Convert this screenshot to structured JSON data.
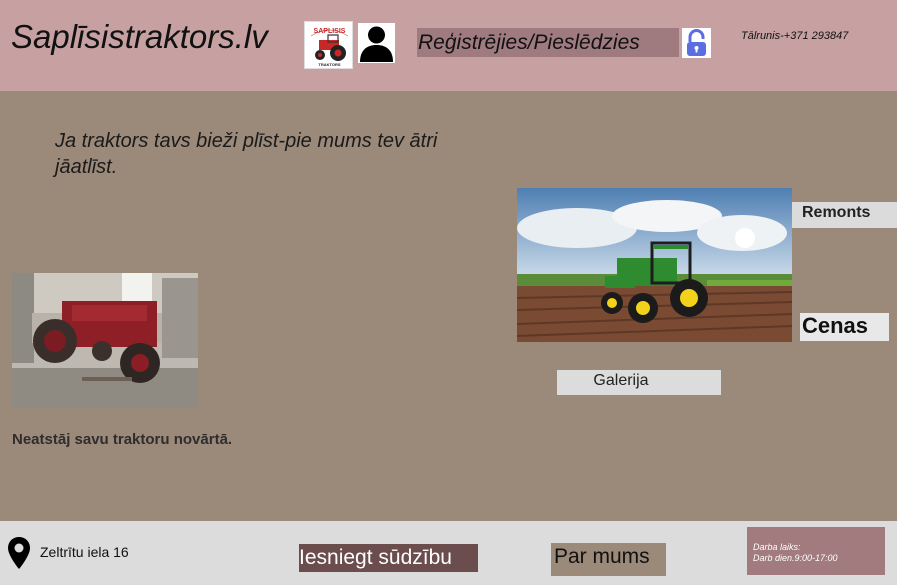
{
  "header": {
    "site_title": "Saplīsistraktors.lv",
    "logo_text": "SAPLISIS",
    "logo_subtext": "TRAKTORS",
    "auth_link": "Reģistrējies/Pieslēdzies",
    "phone": "Tālrunis-+371 293847"
  },
  "main": {
    "slogan": "Ja traktors tavs bieži plīst-pie mums tev ātri jāatlīst.",
    "tagline": "Neatstāj savu traktoru novārtā.",
    "nav": {
      "remonts": "Remonts",
      "cenas": "Cenas",
      "galerija": "Galerija"
    }
  },
  "footer": {
    "address": "Zeltrītu iela 16",
    "complaint_button": "Iesniegt sūdzību",
    "about_button": "Par mums",
    "hours_title": "Darba laiks:",
    "hours_value": "Darb dien.9:00-17:00"
  },
  "colors": {
    "header_bg": "#c7a1a2",
    "main_bg": "#9b8979",
    "footer_bg": "#dcdcdc",
    "auth_link_bg": "#9f7b80",
    "complaint_bg": "#6b4d4d",
    "hours_bg": "#a17b7e",
    "lock_accent": "#5b6ee1"
  },
  "icons": {
    "user": "user-silhouette-icon",
    "lock": "padlock-icon",
    "location": "map-pin-icon"
  }
}
